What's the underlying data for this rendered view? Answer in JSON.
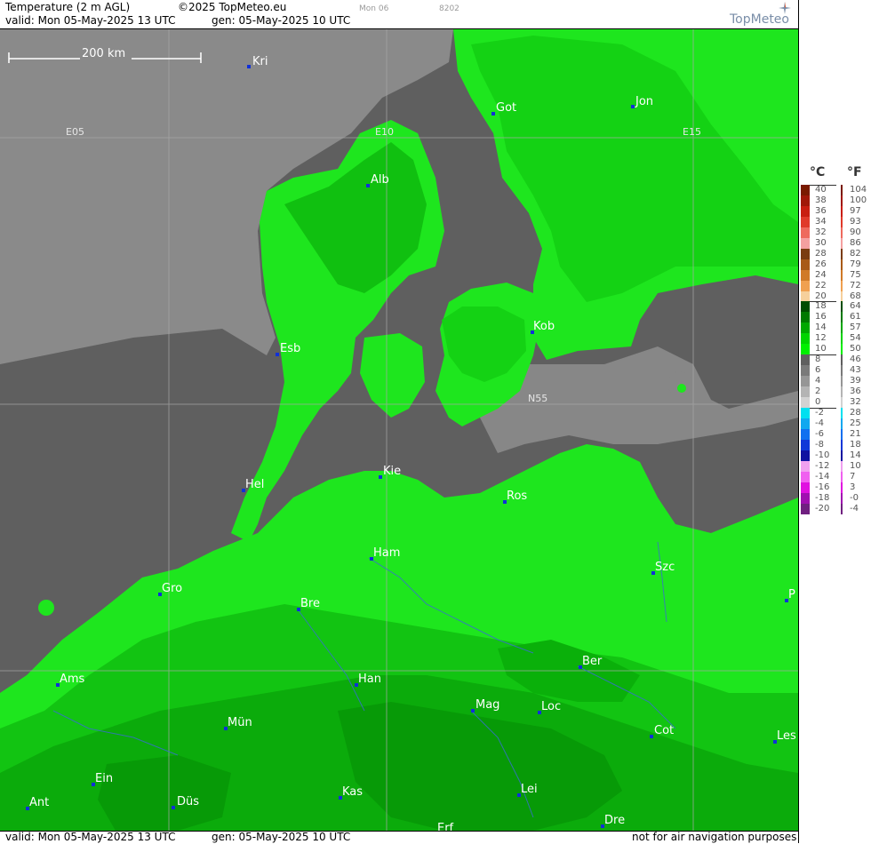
{
  "header": {
    "product": "Temperature (2 m AGL)",
    "copyright": "©2025 TopMeteo.eu",
    "day_code": "Mon 06",
    "frame_code": "8202",
    "valid": "valid:  Mon  05-May-2025  13 UTC",
    "generated": "gen: 05-May-2025 10 UTC",
    "brand": "TopMeteo"
  },
  "footer": {
    "valid": "valid:  Mon  05-May-2025  13 UTC",
    "generated": "gen: 05-May-2025 10 UTC",
    "disclaimer": "not for air navigation purposes"
  },
  "map": {
    "scale_label": "200 km",
    "grid_labels": [
      {
        "id": "e05",
        "text": "E05"
      },
      {
        "id": "e10",
        "text": "E10"
      },
      {
        "id": "e15",
        "text": "E15"
      },
      {
        "id": "n55",
        "text": "N55"
      }
    ],
    "cities": [
      {
        "id": "kri",
        "name": "Kri"
      },
      {
        "id": "got",
        "name": "Got"
      },
      {
        "id": "jon",
        "name": "Jon"
      },
      {
        "id": "alb",
        "name": "Alb"
      },
      {
        "id": "esb",
        "name": "Esb"
      },
      {
        "id": "kob",
        "name": "Kob"
      },
      {
        "id": "kie",
        "name": "Kie"
      },
      {
        "id": "hel",
        "name": "Hel"
      },
      {
        "id": "ros",
        "name": "Ros"
      },
      {
        "id": "ham",
        "name": "Ham"
      },
      {
        "id": "szc",
        "name": "Szc"
      },
      {
        "id": "gro",
        "name": "Gro"
      },
      {
        "id": "bre",
        "name": "Bre"
      },
      {
        "id": "p",
        "name": "P"
      },
      {
        "id": "ber",
        "name": "Ber"
      },
      {
        "id": "ams",
        "name": "Ams"
      },
      {
        "id": "han",
        "name": "Han"
      },
      {
        "id": "mag",
        "name": "Mag"
      },
      {
        "id": "loc",
        "name": "Loc"
      },
      {
        "id": "mun",
        "name": "Mün"
      },
      {
        "id": "cot",
        "name": "Cot"
      },
      {
        "id": "les",
        "name": "Les"
      },
      {
        "id": "ein",
        "name": "Ein"
      },
      {
        "id": "kas",
        "name": "Kas"
      },
      {
        "id": "lei",
        "name": "Lei"
      },
      {
        "id": "ant",
        "name": "Ant"
      },
      {
        "id": "dus",
        "name": "Düs"
      },
      {
        "id": "dre",
        "name": "Dre"
      },
      {
        "id": "erf",
        "name": "Erf"
      }
    ]
  },
  "legend": {
    "celsius_header": "°C",
    "fahrenheit_header": "°F",
    "levels": [
      {
        "c": "40",
        "f": "104",
        "color": "#7a1a00"
      },
      {
        "c": "38",
        "f": "100",
        "color": "#a01808"
      },
      {
        "c": "36",
        "f": "97",
        "color": "#c81e10"
      },
      {
        "c": "34",
        "f": "93",
        "color": "#e03a2a"
      },
      {
        "c": "32",
        "f": "90",
        "color": "#ee6a5e"
      },
      {
        "c": "30",
        "f": "86",
        "color": "#f4a0a0"
      },
      {
        "c": "28",
        "f": "82",
        "color": "#7a3c10"
      },
      {
        "c": "26",
        "f": "79",
        "color": "#a85a18"
      },
      {
        "c": "24",
        "f": "75",
        "color": "#d07a28"
      },
      {
        "c": "22",
        "f": "72",
        "color": "#f0a050"
      },
      {
        "c": "20",
        "f": "68",
        "color": "#f6d09c"
      },
      {
        "c": "18",
        "f": "64",
        "color": "#004d00"
      },
      {
        "c": "16",
        "f": "61",
        "color": "#007a00"
      },
      {
        "c": "14",
        "f": "57",
        "color": "#00a800"
      },
      {
        "c": "12",
        "f": "54",
        "color": "#00d400"
      },
      {
        "c": "10",
        "f": "50",
        "color": "#00f000"
      },
      {
        "c": "8",
        "f": "46",
        "color": "#5f5f5f"
      },
      {
        "c": "6",
        "f": "43",
        "color": "#7a7a7a"
      },
      {
        "c": "4",
        "f": "39",
        "color": "#969696"
      },
      {
        "c": "2",
        "f": "36",
        "color": "#b4b4b4"
      },
      {
        "c": "0",
        "f": "32",
        "color": "#d2d2d2"
      },
      {
        "c": "-2",
        "f": "28",
        "color": "#00e0f0"
      },
      {
        "c": "-4",
        "f": "25",
        "color": "#10a8f0"
      },
      {
        "c": "-6",
        "f": "21",
        "color": "#1070f0"
      },
      {
        "c": "-8",
        "f": "18",
        "color": "#1038d8"
      },
      {
        "c": "-10",
        "f": "14",
        "color": "#1010a0"
      },
      {
        "c": "-12",
        "f": "10",
        "color": "#f0a0f0"
      },
      {
        "c": "-14",
        "f": "7",
        "color": "#f060f0"
      },
      {
        "c": "-16",
        "f": "3",
        "color": "#e010e0"
      },
      {
        "c": "-18",
        "f": "-0",
        "color": "#a010b0"
      },
      {
        "c": "-20",
        "f": "-4",
        "color": "#702080"
      }
    ]
  }
}
